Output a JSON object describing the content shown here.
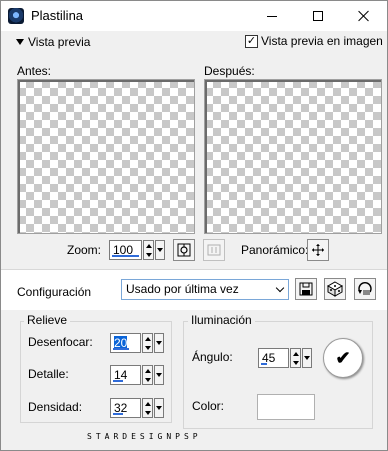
{
  "window": {
    "title": "Plastilina"
  },
  "preview_toggle": {
    "label": "Vista previa"
  },
  "image_preview": {
    "label": "Vista previa en imagen",
    "checked": true,
    "check_glyph": "✓"
  },
  "before": {
    "label": "Antes:"
  },
  "after": {
    "label": "Después:"
  },
  "zoom": {
    "label": "Zoom:",
    "value": "100",
    "pan_label": "Panorámico:"
  },
  "config": {
    "label": "Configuración",
    "preset": "Usado por última vez"
  },
  "relieve": {
    "title": "Relieve",
    "blur": {
      "label": "Desenfocar:",
      "value": "20"
    },
    "detail": {
      "label": "Detalle:",
      "value": "14"
    },
    "density": {
      "label": "Densidad:",
      "value": "32"
    }
  },
  "lighting": {
    "title": "Iluminación",
    "angle": {
      "label": "Ángulo:",
      "value": "45"
    },
    "color": {
      "label": "Color:",
      "value": "#ffffff"
    },
    "dial_glyph": "✔"
  },
  "watermark": "STARDESIGNPSP"
}
